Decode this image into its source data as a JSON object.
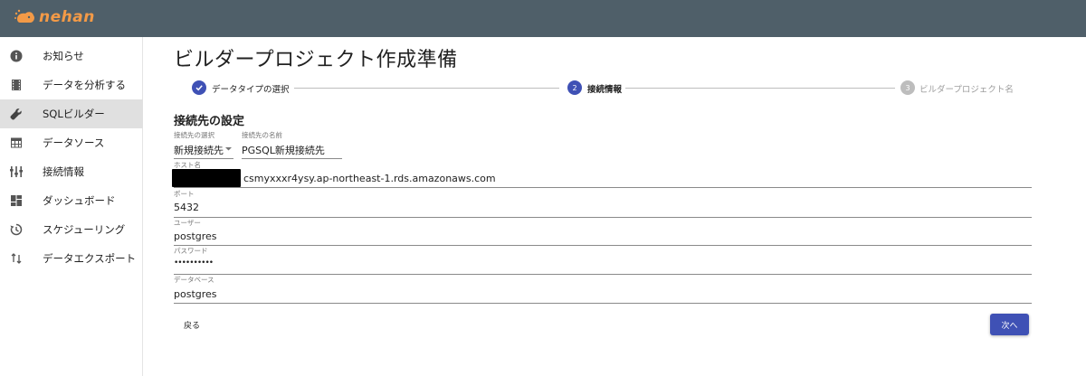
{
  "app": {
    "name": "nehan"
  },
  "sidebar": {
    "items": [
      {
        "label": "お知らせ",
        "icon": "info-icon"
      },
      {
        "label": "データを分析する",
        "icon": "film-strip-icon"
      },
      {
        "label": "SQLビルダー",
        "icon": "wrench-icon",
        "active": true
      },
      {
        "label": "データソース",
        "icon": "table-icon"
      },
      {
        "label": "接続情報",
        "icon": "connection-icon"
      },
      {
        "label": "ダッシュボード",
        "icon": "dashboard-icon"
      },
      {
        "label": "スケジューリング",
        "icon": "schedule-icon"
      },
      {
        "label": "データエクスポート",
        "icon": "export-icon"
      }
    ]
  },
  "page": {
    "title": "ビルダープロジェクト作成準備"
  },
  "stepper": {
    "steps": [
      {
        "num": "✓",
        "label": "データタイプの選択",
        "state": "completed"
      },
      {
        "num": "2",
        "label": "接続情報",
        "state": "active"
      },
      {
        "num": "3",
        "label": "ビルダープロジェクト名",
        "state": "inactive"
      }
    ]
  },
  "form": {
    "section_title": "接続先の設定",
    "connection_select": {
      "label": "接続先の選択",
      "value": "新規接続先"
    },
    "connection_name": {
      "label": "接続先の名前",
      "value": "PGSQL新規接続先"
    },
    "host": {
      "label": "ホスト名",
      "value": "csmyxxxr4ysy.ap-northeast-1.rds.amazonaws.com"
    },
    "port": {
      "label": "ポート",
      "value": "5432"
    },
    "user": {
      "label": "ユーザー",
      "value": "postgres"
    },
    "password": {
      "label": "パスワード",
      "value": "••••••••••"
    },
    "database": {
      "label": "データベース",
      "value": "postgres"
    }
  },
  "actions": {
    "back_label": "戻る",
    "next_label": "次へ"
  },
  "colors": {
    "topbar": "#4f5f69",
    "brand": "#f39a47",
    "primary": "#3f51b5",
    "active_nav": "#e0e0e0",
    "inactive_step": "#bdbdbd"
  }
}
